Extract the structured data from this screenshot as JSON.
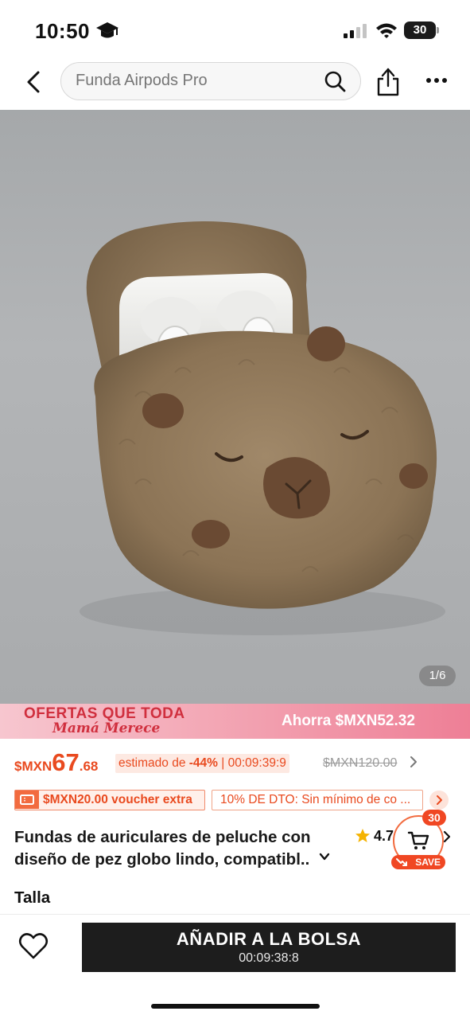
{
  "status_bar": {
    "time": "10:50",
    "battery": "30"
  },
  "search": {
    "placeholder": "Funda Airpods Pro"
  },
  "gallery": {
    "counter": "1/6"
  },
  "promo": {
    "title": "OFERTAS QUE TODA",
    "subtitle": "Mamá Merece",
    "savings": "Ahorra $MXN52.32"
  },
  "price": {
    "currency": "$MXN",
    "integer": "67",
    "decimal": ".68",
    "estimated_prefix": "estimado de",
    "discount": "-44%",
    "separator": "|",
    "countdown": "00:09:39:9",
    "original": "$MXN120.00"
  },
  "coupons": {
    "voucher": "$MXN20.00 voucher extra",
    "discount": "10% DE DTO: Sin mínimo de co ..."
  },
  "product": {
    "title": "Fundas de auriculares de peluche con diseño de pez globo lindo, compatibl..",
    "rating": "4.7",
    "size_label": "Talla"
  },
  "cart": {
    "count": "30",
    "save_label": "SAVE"
  },
  "bottom": {
    "add_to_bag": "AÑADIR A LA BOLSA",
    "timer": "00:09:38:8"
  },
  "colors": {
    "accent": "#e94a1f",
    "primary_button": "#1d1d1d",
    "promo_pink": "#f3a7b5"
  }
}
